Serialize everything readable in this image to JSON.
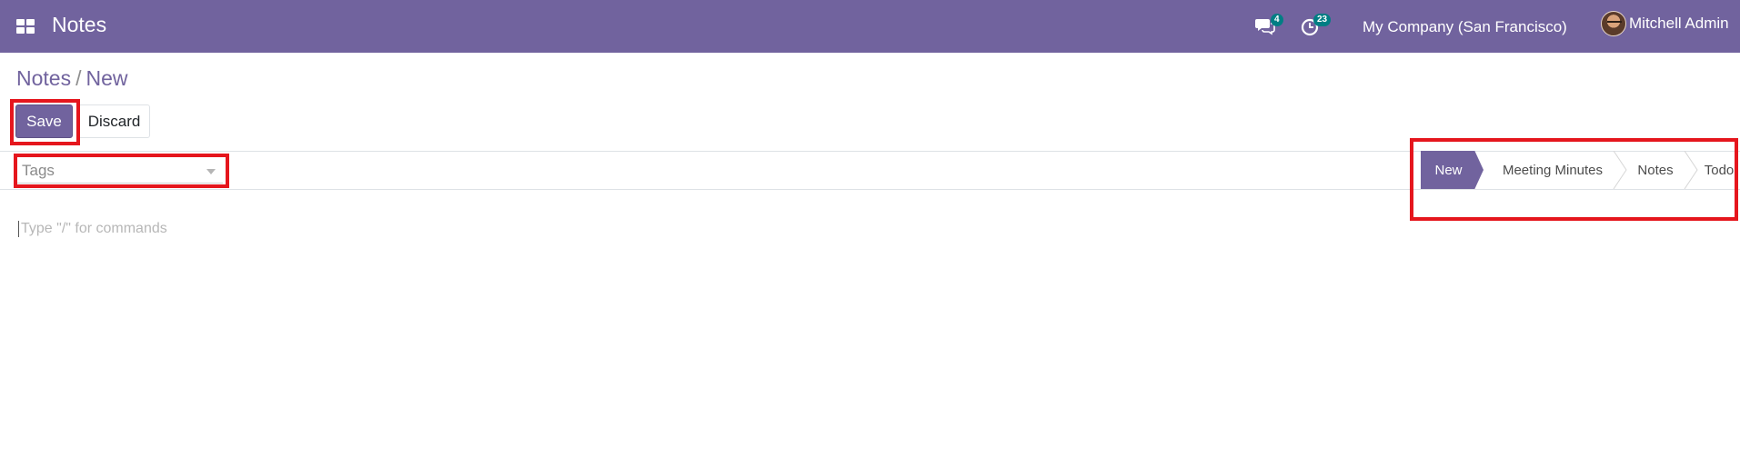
{
  "header": {
    "app_name": "Notes",
    "apps_icon": "grid-icon",
    "messages_icon": "chat-bubbles-icon",
    "messages_count": "4",
    "activities_icon": "clock-icon",
    "activities_count": "23",
    "company": "My Company (San Francisco)",
    "user_name": "Mitchell Admin"
  },
  "breadcrumb": {
    "parent": "Notes",
    "separator": "/",
    "current": "New"
  },
  "toolbar": {
    "save_label": "Save",
    "discard_label": "Discard"
  },
  "form": {
    "tags_placeholder": "Tags",
    "editor_placeholder": "Type \"/\" for commands"
  },
  "stages": {
    "active": "New",
    "items": [
      "New",
      "Meeting Minutes",
      "Notes",
      "Todo"
    ]
  },
  "colors": {
    "brand": "#71639e",
    "badge": "#017e84",
    "highlight": "#e5161d"
  }
}
